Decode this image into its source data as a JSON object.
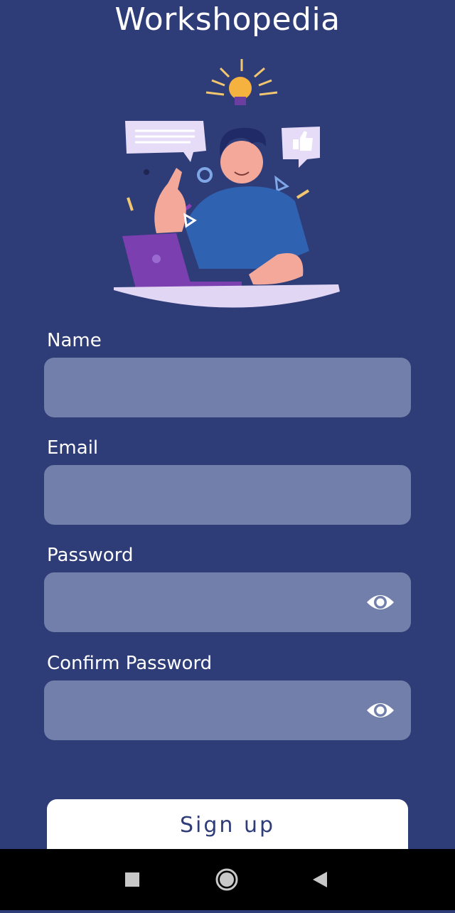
{
  "app": {
    "title": "Workshopedia"
  },
  "form": {
    "name_label": "Name",
    "email_label": "Email",
    "password_label": "Password",
    "confirm_label": "Confirm Password",
    "name_value": "",
    "email_value": "",
    "password_value": "",
    "confirm_value": ""
  },
  "actions": {
    "signup_label": "Sign up"
  },
  "icons": {
    "password_toggle": "eye-icon",
    "nav_recents": "square-icon",
    "nav_home": "circle-icon",
    "nav_back": "triangle-back-icon"
  },
  "colors": {
    "background": "#2e3c78",
    "field": "#717faa",
    "button": "#ffffff",
    "button_text": "#2e3c78",
    "navbar": "#000000"
  }
}
